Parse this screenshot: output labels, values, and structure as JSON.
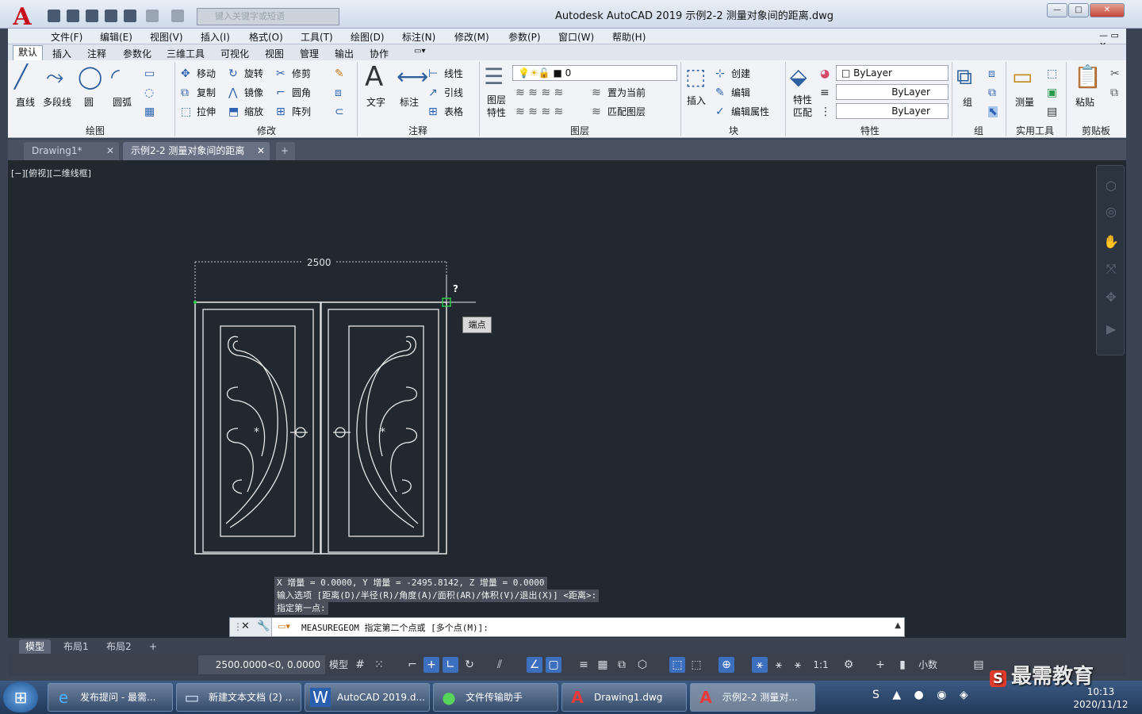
{
  "window": {
    "title": "Autodesk AutoCAD 2019    示例2-2  测量对象间的距离.dwg",
    "search_placeholder": "键入关键字或短语",
    "logo": "A"
  },
  "menu": [
    "文件(F)",
    "编辑(E)",
    "视图(V)",
    "插入(I)",
    "格式(O)",
    "工具(T)",
    "绘图(D)",
    "标注(N)",
    "修改(M)",
    "参数(P)",
    "窗口(W)",
    "帮助(H)"
  ],
  "ribbon_tabs": [
    "默认",
    "插入",
    "注释",
    "参数化",
    "三维工具",
    "可视化",
    "视图",
    "管理",
    "输出",
    "协作"
  ],
  "draw": {
    "line": "直线",
    "polyline": "多段线",
    "circle": "圆",
    "arc": "圆弧",
    "title": "绘图"
  },
  "modify": {
    "move": "移动",
    "rotate": "旋转",
    "trim": "修剪",
    "copy": "复制",
    "mirror": "镜像",
    "fillet": "圆角",
    "stretch": "拉伸",
    "scale": "缩放",
    "array": "阵列",
    "title": "修改"
  },
  "annotation": {
    "text": "文字",
    "dim": "标注",
    "linear": "线性",
    "leader": "引线",
    "table": "表格",
    "title": "注释"
  },
  "layers": {
    "props": "图层\n特性",
    "current_layer": "0",
    "set_current": "置为当前",
    "match": "匹配图层",
    "title": "图层"
  },
  "block": {
    "insert": "插入",
    "create": "创建",
    "edit": "编辑",
    "edit_attr": "编辑属性",
    "title": "块"
  },
  "properties": {
    "match": "特性\n匹配",
    "color": "ByLayer",
    "linetype": "ByLayer",
    "lineweight": "ByLayer",
    "title": "特性"
  },
  "groups": {
    "group": "组",
    "title": "组"
  },
  "utilities": {
    "measure": "测量",
    "title": "实用工具"
  },
  "clipboard": {
    "paste": "粘贴",
    "title": "剪贴板"
  },
  "doc_tabs": [
    "Drawing1*",
    "示例2-2  测量对象间的距离"
  ],
  "view_label": "[−][俯视][二维线框]",
  "drawing": {
    "dimension": "2500",
    "tooltip": "端点",
    "question": "?"
  },
  "history": [
    "X 增量 = 0.0000,   Y 增量 = -2495.8142,   Z 增量 = 0.0000",
    "输入选项 [距离(D)/半径(R)/角度(A)/面积(AR)/体积(V)/退出(X)] <距离>:",
    "指定第一点:"
  ],
  "command": {
    "prompt": "MEASUREGEOM 指定第二个点或 [多个点(M)]:"
  },
  "layout_tabs": [
    "模型",
    "布局1",
    "布局2"
  ],
  "status": {
    "coords": "2500.0000<0, 0.0000",
    "model": "模型",
    "scale": "1:1",
    "units": "小数"
  },
  "taskbar": [
    "发布提问 - 最需...",
    "新建文本文档 (2) ...",
    "AutoCAD 2019.d...",
    "文件传输助手",
    "Drawing1.dwg",
    "示例2-2  测量对..."
  ],
  "clock": {
    "time": "10:13",
    "date": "2020/11/12"
  },
  "watermark": "最需教育",
  "colors": {
    "canvas": "#212830",
    "accent": "#3c6fbe",
    "logo_red": "#c8101e"
  }
}
